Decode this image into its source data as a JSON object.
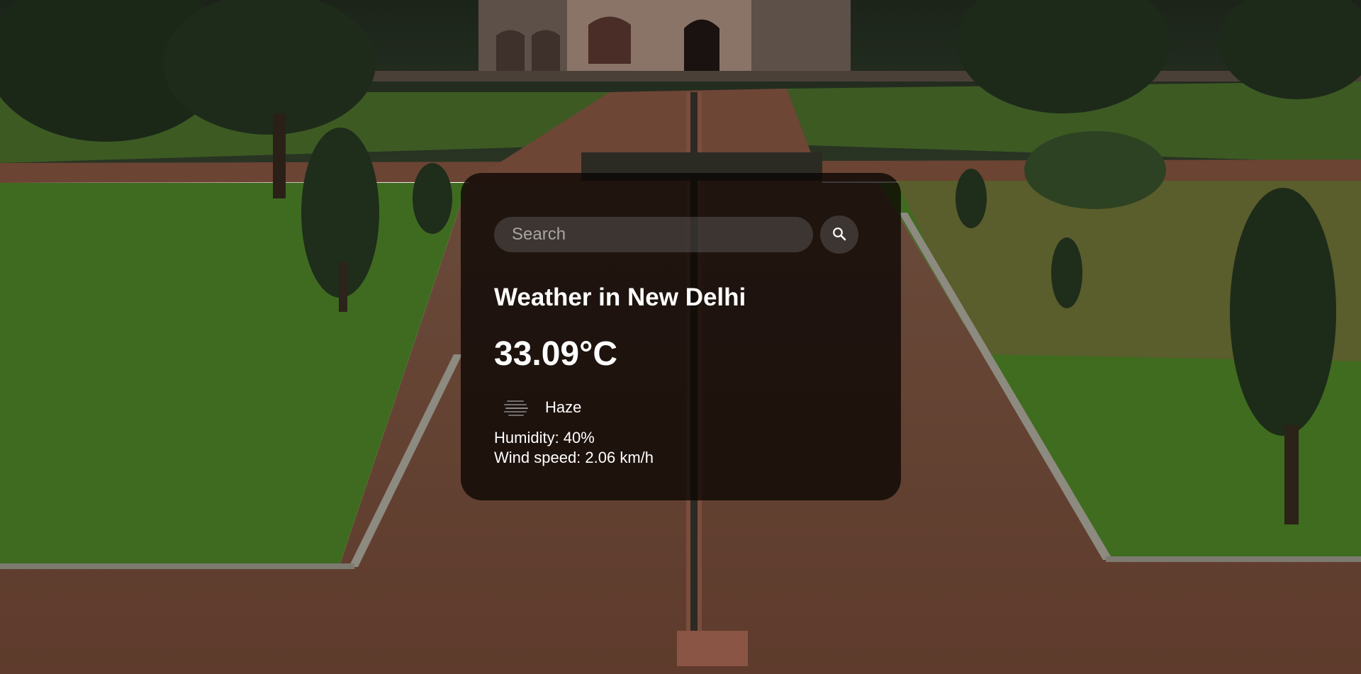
{
  "search": {
    "placeholder": "Search",
    "button_icon": "search-icon"
  },
  "weather": {
    "title": "Weather in New Delhi",
    "temperature": "33.09°C",
    "condition_icon": "haze-icon",
    "condition": "Haze",
    "humidity": "Humidity: 40%",
    "wind": "Wind speed: 2.06 km/h"
  },
  "colors": {
    "card_background": "#0a0503",
    "text": "#ffffff",
    "input_background": "#7d7d7d"
  }
}
